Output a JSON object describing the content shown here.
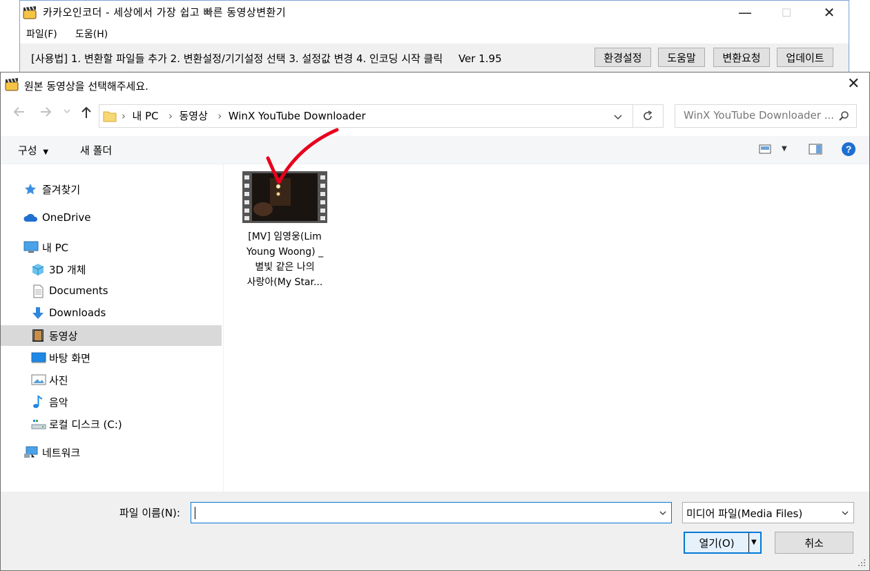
{
  "app": {
    "title": "카카오인코더 - 세상에서 가장 쉽고 빠른 동영상변환기",
    "menu": [
      "파일(F)",
      "도움(H)"
    ],
    "usage": "[사용법] 1. 변환할 파일들 추가   2. 변환설정/기기설정 선택   3. 설정값 변경   4. 인코딩 시작 클릭",
    "version": "Ver 1.95",
    "buttons": [
      "환경설정",
      "도움말",
      "변환요청",
      "업데이트"
    ],
    "window_controls": {
      "minimize": "—",
      "maximize": "☐",
      "close": "✕"
    }
  },
  "dialog": {
    "title": "원본 동영상을 선택해주세요.",
    "close": "✕",
    "breadcrumb": [
      "내 PC",
      "동영상",
      "WinX YouTube Downloader"
    ],
    "search_placeholder": "WinX YouTube Downloader ...",
    "toolbar": {
      "organize": "구성",
      "new_folder": "새 폴더"
    },
    "nav": {
      "favorites": "즐겨찾기",
      "onedrive": "OneDrive",
      "this_pc": "내 PC",
      "items": [
        "3D 개체",
        "Documents",
        "Downloads",
        "동영상",
        "바탕 화면",
        "사진",
        "음악",
        "로컬 디스크 (C:)"
      ],
      "network": "네트워크",
      "selected": "동영상"
    },
    "files": [
      {
        "name_lines": [
          "[MV] 임영웅(Lim",
          "Young Woong) _",
          "별빛 같은 나의",
          "사랑아(My Star..."
        ],
        "type": "video"
      }
    ],
    "filename_label": "파일 이름(N):",
    "filename_value": "",
    "filter": "미디어 파일(Media Files)",
    "open_button": "열기(O)",
    "cancel_button": "취소"
  },
  "colors": {
    "accent": "#0078d7",
    "selection": "#d9d9d9",
    "annotation": "#e8001c",
    "help": "#1e6fd0"
  }
}
